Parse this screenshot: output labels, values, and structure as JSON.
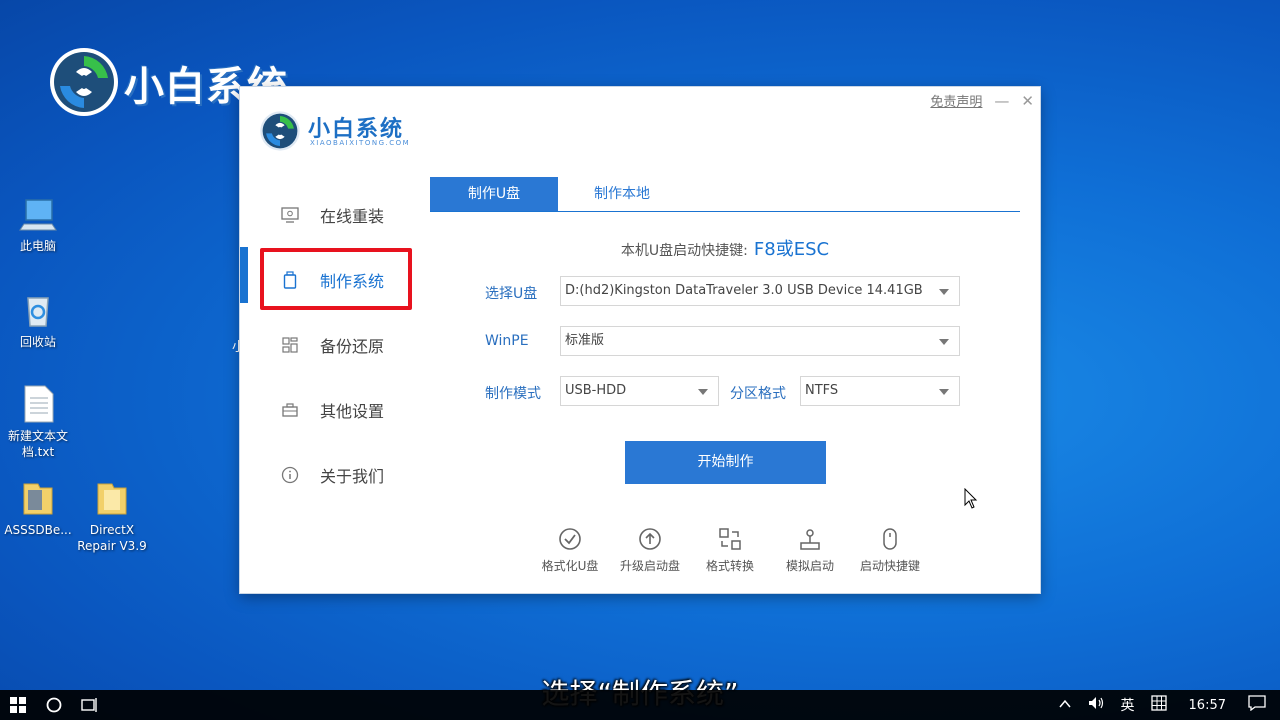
{
  "watermark": {
    "brand": "小白系统"
  },
  "desktop": {
    "icons": [
      {
        "label": "此电脑"
      },
      {
        "label": "回收站"
      },
      {
        "label": "新建文本文档.txt"
      },
      {
        "label": "ASSSDBe..."
      },
      {
        "label": "DirectX Repair V3.9"
      }
    ],
    "stray_char": "小"
  },
  "app": {
    "brand": "小白系统",
    "brand_sub": "XIAOBAIXITONG.COM",
    "controls": {
      "disclaimer": "免责声明",
      "minimize": "—",
      "close": "✕"
    },
    "sidebar": [
      {
        "label": "在线重装",
        "icon": "monitor-icon"
      },
      {
        "label": "制作系统",
        "icon": "usb-drive-icon",
        "active": true
      },
      {
        "label": "备份还原",
        "icon": "grid-icon"
      },
      {
        "label": "其他设置",
        "icon": "toolbox-icon"
      },
      {
        "label": "关于我们",
        "icon": "info-icon"
      }
    ],
    "tabs": [
      {
        "label": "制作U盘",
        "active": true
      },
      {
        "label": "制作本地",
        "active": false
      }
    ],
    "hotkey": {
      "label": "本机U盘启动快捷键:",
      "value": "F8或ESC"
    },
    "form": {
      "usb_label": "选择U盘",
      "usb_value": "D:(hd2)Kingston DataTraveler 3.0 USB Device 14.41GB",
      "winpe_label": "WinPE",
      "winpe_value": "标准版",
      "mode_label": "制作模式",
      "mode_value": "USB-HDD",
      "partition_label": "分区格式",
      "partition_value": "NTFS"
    },
    "start_button": "开始制作",
    "tools": [
      {
        "label": "格式化U盘",
        "icon": "check-circle-icon"
      },
      {
        "label": "升级启动盘",
        "icon": "upload-circle-icon"
      },
      {
        "label": "格式转换",
        "icon": "convert-icon"
      },
      {
        "label": "模拟启动",
        "icon": "joystick-icon"
      },
      {
        "label": "启动快捷键",
        "icon": "mouse-icon"
      }
    ]
  },
  "subtitle": "选择“制作系统”",
  "taskbar": {
    "volume_icon": "volume-icon",
    "ime": "英",
    "time": "16:57"
  },
  "colors": {
    "accent": "#2a78d4",
    "highlight": "#e8121e"
  }
}
